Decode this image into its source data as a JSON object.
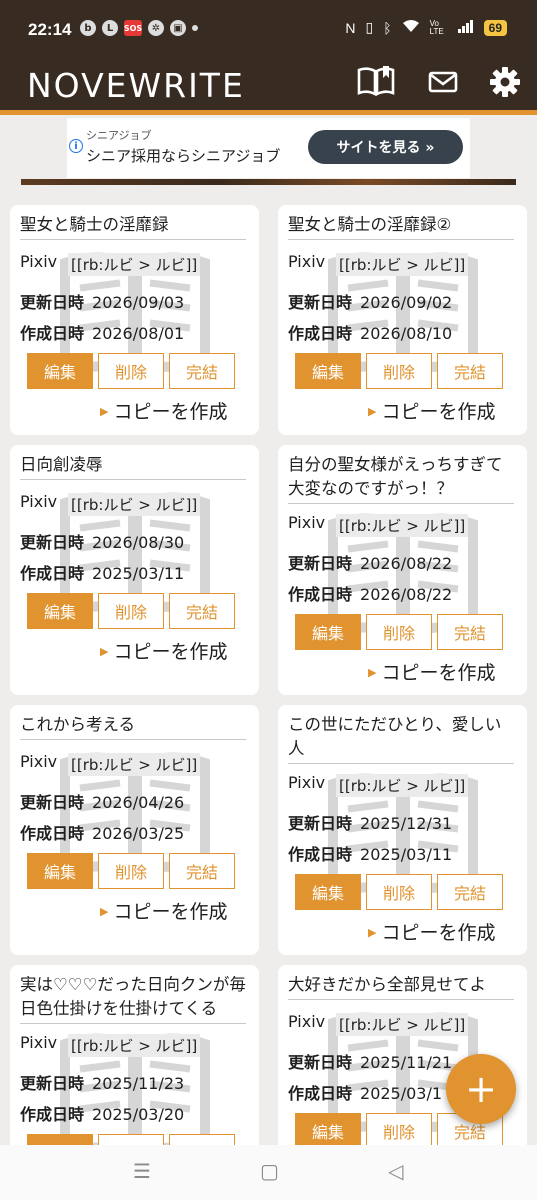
{
  "status_bar": {
    "time": "22:14",
    "sos": "SOS",
    "volte": "Vo LTE",
    "battery": "69"
  },
  "header": {
    "logo": "NOVEWRITE"
  },
  "ad": {
    "small": "シニアジョブ",
    "main": "シニア採用ならシニアジョブ",
    "button": "サイトを見る »"
  },
  "labels": {
    "source": "Pixiv",
    "ruby": "[[rb:ルビ > ルビ]]",
    "updated": "更新日時",
    "created": "作成日時",
    "edit": "編集",
    "delete": "削除",
    "complete": "完結",
    "copy": "コピーを作成"
  },
  "cards": [
    {
      "title": "聖女と騎士の淫靡録",
      "updated": "2026/09/03",
      "created": "2026/08/01"
    },
    {
      "title": "聖女と騎士の淫靡録②",
      "updated": "2026/09/02",
      "created": "2026/08/10"
    },
    {
      "title": "日向創凌辱",
      "updated": "2026/08/30",
      "created": "2025/03/11"
    },
    {
      "title": "自分の聖女様がえっちすぎて大変なのですがっ！？",
      "updated": "2026/08/22",
      "created": "2026/08/22"
    },
    {
      "title": "これから考える",
      "updated": "2026/04/26",
      "created": "2026/03/25"
    },
    {
      "title": "この世にただひとり、愛しい人",
      "updated": "2025/12/31",
      "created": "2025/03/11"
    },
    {
      "title": "実は♡♡♡だった日向クンが毎日色仕掛けを仕掛けてくる",
      "updated": "2025/11/23",
      "created": "2025/03/20"
    },
    {
      "title": "大好きだから全部見せてよ",
      "updated": "2025/11/21",
      "created": "2025/03/1"
    }
  ],
  "fab": {
    "label": "+"
  },
  "navbar": {
    "menu": "☰",
    "home": "▢",
    "back": "◁"
  },
  "colors": {
    "header": "#382b22",
    "accent": "#e0932f"
  }
}
